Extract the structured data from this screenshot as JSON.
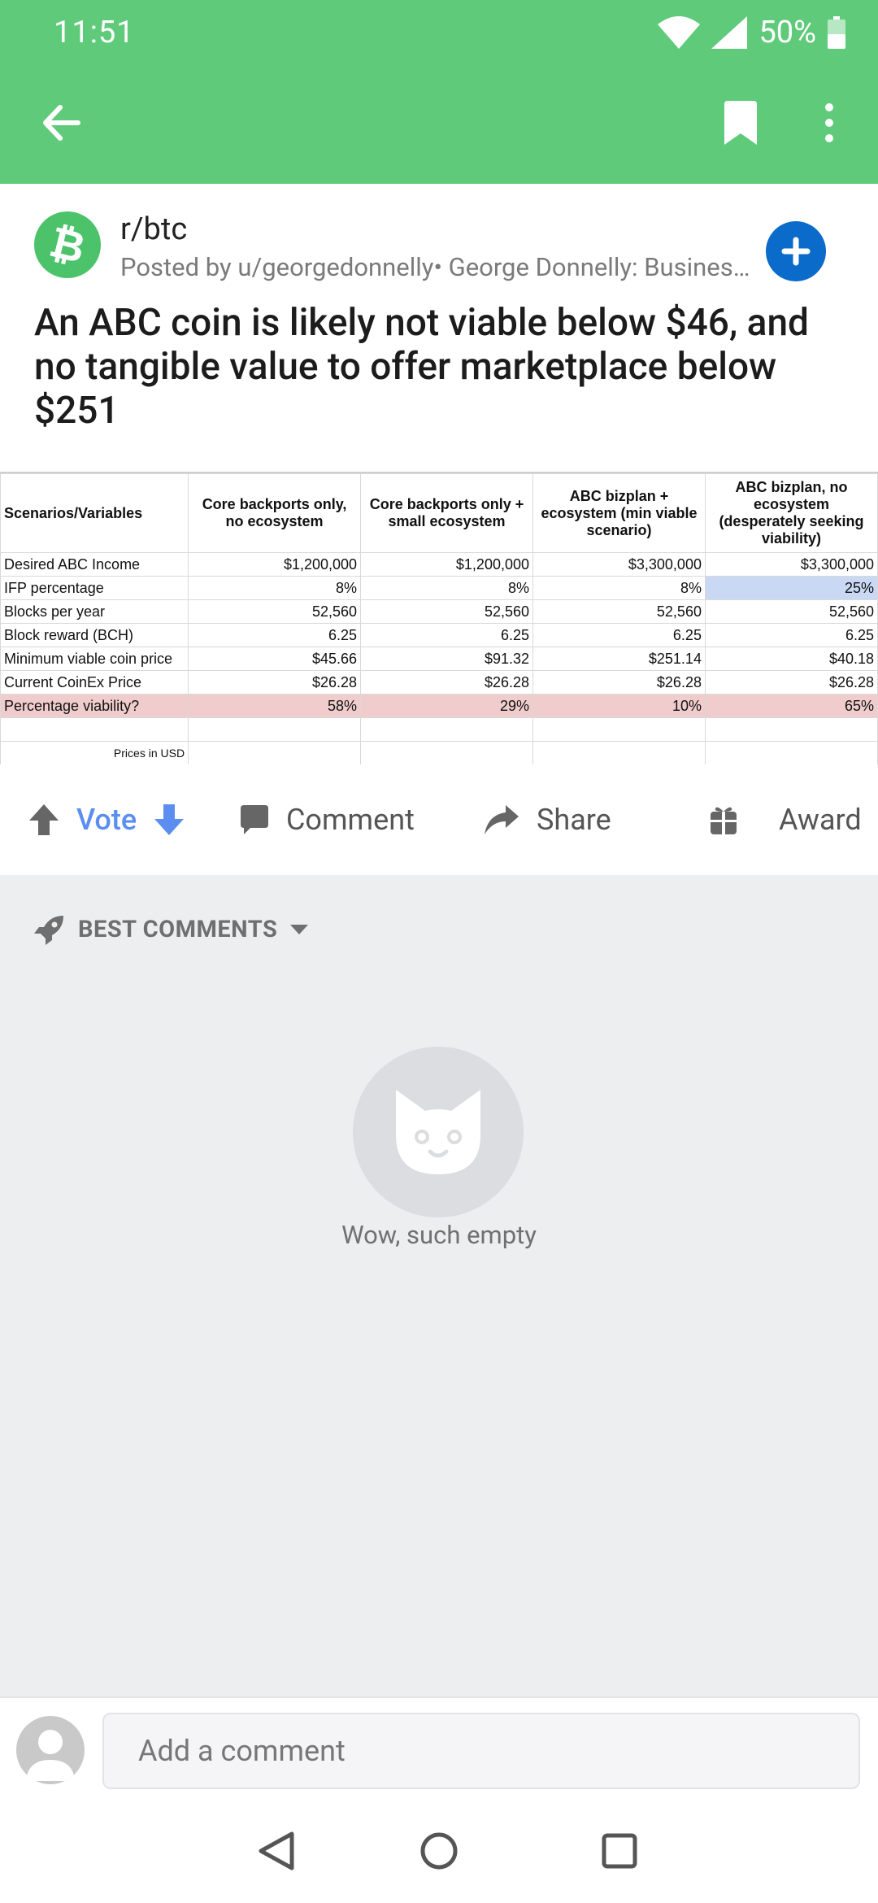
{
  "colors": {
    "appbar": "#5fcb7a",
    "subreddit_icon": "#4cc36b",
    "join_button": "#0b6bcb",
    "vote_blue": "#5b8ef0",
    "comments_bg": "#edeef0"
  },
  "status_bar": {
    "time": "11:51",
    "battery": "50%",
    "icons": [
      "wifi-icon",
      "signal-icon",
      "battery-icon"
    ]
  },
  "toolbar": {
    "icons": [
      "back-arrow-icon",
      "bookmark-icon",
      "more-vert-icon"
    ]
  },
  "post": {
    "subreddit": "r/btc",
    "posted_by": "Posted by u/georgedonnelly• George Donnelly: Business Development: Read.Cash, Noise.Cash",
    "title": "An ABC coin is likely not viable below $46, and no tangible value to offer marketplace below $251"
  },
  "table": {
    "headers": [
      "Scenarios/Variables",
      "Core backports only, no ecosystem",
      "Core backports only + small ecosystem",
      "ABC bizplan + ecosystem (min viable scenario)",
      "ABC bizplan, no ecosystem (desperately seeking viability)"
    ],
    "rows": [
      {
        "label": "Desired ABC Income",
        "cells": [
          "$1,200,000",
          "$1,200,000",
          "$3,300,000",
          "$3,300,000"
        ]
      },
      {
        "label": "IFP percentage",
        "cells": [
          "8%",
          "8%",
          "8%",
          "25%"
        ]
      },
      {
        "label": "Blocks per year",
        "cells": [
          "52,560",
          "52,560",
          "52,560",
          "52,560"
        ]
      },
      {
        "label": "Block reward (BCH)",
        "cells": [
          "6.25",
          "6.25",
          "6.25",
          "6.25"
        ]
      },
      {
        "label": "Minimum viable coin price",
        "cells": [
          "$45.66",
          "$91.32",
          "$251.14",
          "$40.18"
        ]
      },
      {
        "label": "Current CoinEx Price",
        "cells": [
          "$26.28",
          "$26.28",
          "$26.28",
          "$26.28"
        ]
      },
      {
        "label": "Percentage viability?",
        "cells": [
          "58%",
          "29%",
          "10%",
          "65%"
        ]
      }
    ],
    "footnote": "Prices in USD"
  },
  "actions": {
    "vote": "Vote",
    "comment": "Comment",
    "share": "Share",
    "award": "Award"
  },
  "comments": {
    "sort_label": "BEST COMMENTS",
    "empty_text": "Wow, such empty"
  },
  "comment_bar": {
    "placeholder": "Add a comment"
  },
  "nav": {
    "icons": [
      "back-triangle-icon",
      "home-circle-icon",
      "recents-square-icon"
    ]
  }
}
